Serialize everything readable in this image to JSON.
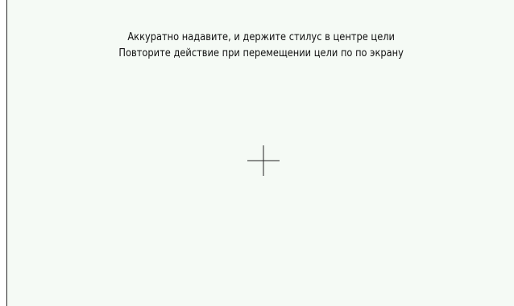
{
  "calibration": {
    "instruction_line_1": "Аккуратно надавите, и держите стилус в центре цели",
    "instruction_line_2": "Повторите действие при перемещении цели по по экрану",
    "target_icon": "crosshair-icon",
    "background_color": "#f5faf5",
    "text_color": "#111111"
  }
}
